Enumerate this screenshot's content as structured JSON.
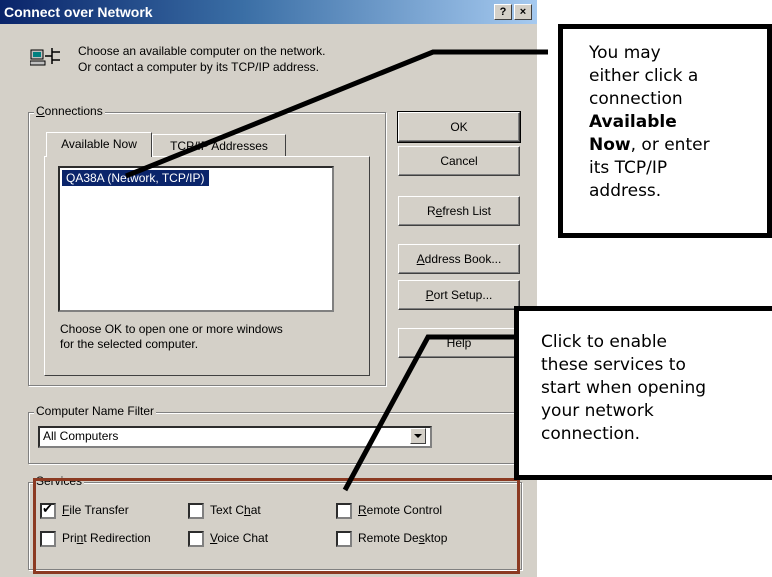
{
  "window": {
    "title": "Connect over Network",
    "help_button": "?",
    "close_button": "×"
  },
  "intro": {
    "line1": "Choose an available computer on the network.",
    "line2": "Or contact a computer by its TCP/IP address."
  },
  "connections": {
    "group_label_first": "C",
    "group_label_rest": "onnections",
    "tabs": [
      {
        "label": "Available Now",
        "selected": true
      },
      {
        "label": "TCP/IP Addresses",
        "selected": false
      }
    ],
    "list_items": [
      {
        "label": "QA38A (Network, TCP/IP)",
        "selected": true
      }
    ],
    "hint_line1": "Choose OK to open one or more windows",
    "hint_line2": "for the selected computer."
  },
  "buttons": {
    "ok": "OK",
    "cancel": "Cancel",
    "refresh_pre": "R",
    "refresh_u": "e",
    "refresh_post": "fresh List",
    "address_u": "A",
    "address_post": "ddress Book...",
    "port_u": "P",
    "port_post": "ort Setup...",
    "help": "Help"
  },
  "filter": {
    "group_label": "Computer Name Filter",
    "selected_value": "All Computers"
  },
  "services": {
    "group_label": "Services",
    "items": [
      {
        "pre": "",
        "u": "F",
        "post": "ile Transfer",
        "checked": true
      },
      {
        "pre": "Text C",
        "u": "h",
        "post": "at",
        "checked": false
      },
      {
        "pre": "",
        "u": "R",
        "post": "emote Control",
        "checked": false
      },
      {
        "pre": "Pri",
        "u": "n",
        "post": "t Redirection",
        "checked": false
      },
      {
        "pre": "",
        "u": "V",
        "post": "oice Chat",
        "checked": false
      },
      {
        "pre": "Remote De",
        "u": "s",
        "post": "ktop",
        "checked": false
      }
    ]
  },
  "callouts": {
    "top": {
      "line1": "You may",
      "line2": "either click a",
      "line3": "connection",
      "line4": "Available",
      "line5_bold": "Now",
      "line5_rest": ", or enter",
      "line6": "its TCP/IP",
      "line7": "address."
    },
    "bottom": {
      "line1": "Click to enable",
      "line2": "these services to",
      "line3": "start when opening",
      "line4": "your network",
      "line5": "connection."
    }
  },
  "colors": {
    "title_bar_start": "#0a246a",
    "dialog_face": "#d4d0c8",
    "selection": "#0a246a",
    "services_highlight": "#8b3a22"
  }
}
